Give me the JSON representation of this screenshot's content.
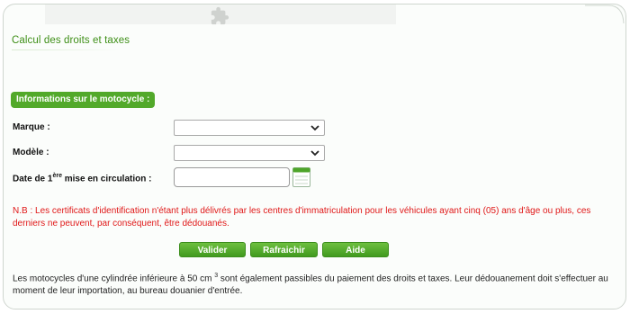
{
  "page_title": "Calcul des droits et taxes",
  "section_title": "Informations sur le motocycle :",
  "fields": {
    "marque": {
      "label": "Marque :",
      "value": ""
    },
    "modele": {
      "label": "Modèle :",
      "value": ""
    },
    "date": {
      "label_before": "Date de 1",
      "label_sup": "ère",
      "label_after": " mise en circulation :",
      "value": "",
      "placeholder": ""
    }
  },
  "notice": "N.B : Les certificats d'identification n'étant plus délivrés par les centres d'immatriculation pour les véhicules ayant cinq (05) ans d'âge ou plus, ces derniers ne peuvent, par conséquent, être dédouanés.",
  "buttons": {
    "valider": "Valider",
    "rafraichir": "Rafraichir",
    "aide": "Aide"
  },
  "footer": {
    "before": "Les motocycles d'une cylindrée inférieure à 50 cm",
    "sup": "3",
    "after": " sont également passibles du paiement des droits et taxes. Leur dédouanement doit s'effectuer au moment de leur importation, au bureau douanier d'entrée."
  },
  "icons": {
    "header": "puzzle-icon",
    "select": "chevron-down-icon",
    "date": "calendar-icon"
  },
  "colors": {
    "accent_green": "#52a92a",
    "title_green": "#3e8f17",
    "notice_red": "#e01818"
  }
}
